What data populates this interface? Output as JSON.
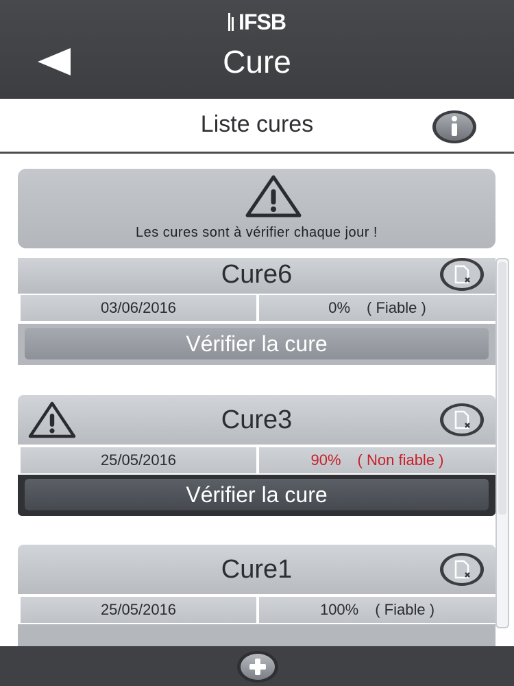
{
  "app": {
    "logo_text": "IFSB",
    "title": "Cure"
  },
  "subheader": {
    "title": "Liste cures"
  },
  "banner": {
    "text": "Les cures sont à vérifier chaque jour !"
  },
  "cures": [
    {
      "name": "Cure6",
      "date": "03/06/2016",
      "percent": "0%",
      "status": "( Fiable )",
      "warning": false,
      "verify_label": "Vérifier la cure"
    },
    {
      "name": "Cure3",
      "date": "25/05/2016",
      "percent": "90%",
      "status": "( Non fiable )",
      "warning": true,
      "verify_label": "Vérifier la cure"
    },
    {
      "name": "Cure1",
      "date": "25/05/2016",
      "percent": "100%",
      "status": "( Fiable )",
      "warning": false
    }
  ],
  "colors": {
    "header_bg": "#424447",
    "card_bg": "#c3c6cb",
    "unreliable": "#c8202a",
    "active_verify_bg": "#2f3134"
  },
  "icons": {
    "back": "back-arrow-icon",
    "info": "info-icon",
    "warning": "warning-triangle-icon",
    "delete": "delete-document-icon",
    "add": "add-plus-icon"
  }
}
